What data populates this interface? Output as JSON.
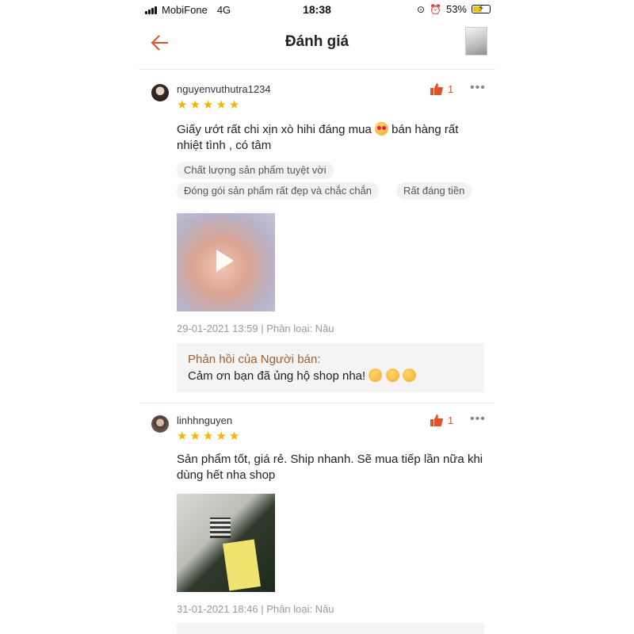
{
  "status_bar": {
    "carrier": "MobiFone",
    "network": "4G",
    "time": "18:38",
    "battery": "53%",
    "battery_level": 0.53
  },
  "header": {
    "title": "Đánh giá"
  },
  "reviews": [
    {
      "username": "nguyenvuthutra1234",
      "rating": 5,
      "likes": "1",
      "text_before_emoji": "Giấy ướt rất chi xịn xò hihi đáng mua ",
      "text_after_emoji": " bán hàng rất nhiệt tình , có tâm",
      "tags": [
        "Chất lượng sản phẩm tuyệt vời",
        "Đóng gói sản phẩm rất đẹp và chắc chắn",
        "Rất đáng tiền"
      ],
      "meta": "29-01-2021 13:59 | Phân loại: Nâu",
      "reply_title": "Phản hồi của Người bán:",
      "reply_text": "Cảm ơn bạn đã ủng hộ shop nha! "
    },
    {
      "username": "linhhnguyen",
      "rating": 5,
      "likes": "1",
      "text": "Sản phẩm tốt, giá rẻ. Ship nhanh. Sẽ mua tiếp lần nữa khi dùng hết nha shop",
      "meta": "31-01-2021 18:46 | Phân loại: Nâu"
    }
  ],
  "colors": {
    "accent": "#e0522c",
    "star": "#f5b400",
    "reply_title": "#a0622f"
  }
}
